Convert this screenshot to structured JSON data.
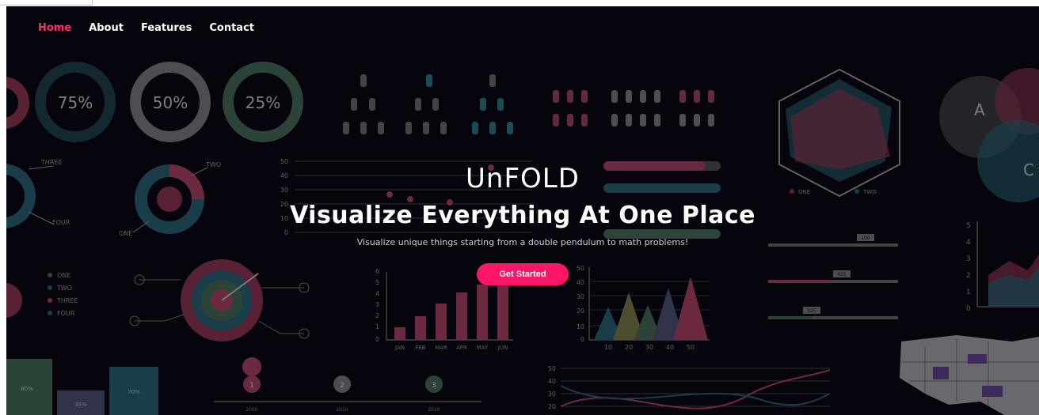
{
  "nav": {
    "items": [
      {
        "label": "Home",
        "active": true
      },
      {
        "label": "About",
        "active": false
      },
      {
        "label": "Features",
        "active": false
      },
      {
        "label": "Contact",
        "active": false
      }
    ]
  },
  "hero": {
    "brand": "UnFOLD",
    "headline": "Visualize Everything At One Place",
    "tagline": "Visualize unique things starting from a double pendulum to math problems!",
    "cta_label": "Get Started"
  },
  "background_decor": {
    "donuts": [
      "75%",
      "50%",
      "25%"
    ],
    "donut_segment_labels": [
      "THREE",
      "FOUR",
      "TWO",
      "ONE"
    ],
    "legend_items": [
      "ONE",
      "TWO",
      "THREE",
      "FOUR"
    ],
    "venn_labels": [
      "A",
      "C"
    ],
    "radar_legend": [
      "ONE",
      "TWO"
    ],
    "line_chart_y_ticks": [
      "50",
      "40",
      "30",
      "20",
      "10",
      "0"
    ],
    "bar_chart_months": [
      "JAN",
      "FEB",
      "MAR",
      "APR",
      "MAY",
      "JUN"
    ],
    "bar_chart_y_ticks": [
      "6",
      "5",
      "4",
      "3",
      "2",
      "1",
      "0"
    ],
    "triangle_chart_x_ticks": [
      "10",
      "20",
      "30",
      "40",
      "50"
    ],
    "triangle_chart_y_ticks": [
      "50",
      "40",
      "30",
      "20",
      "10",
      "0"
    ],
    "area_chart_y_ticks": [
      "5",
      "4",
      "3",
      "2",
      "1",
      "0"
    ],
    "wave_chart_y_ticks": [
      "50",
      "40",
      "30",
      "20"
    ],
    "bottom_bars": [
      "80%",
      "35%",
      "70%"
    ],
    "slider_badges": [
      "100",
      "425",
      "325"
    ],
    "map_pins": [
      "1",
      "2",
      "3"
    ],
    "map_pin_captions": [
      "2000",
      "2010",
      "2020"
    ]
  },
  "colors": {
    "accent": "#ff1667",
    "background": "#06040d",
    "teal": "#2a6f7a",
    "rose": "#9b3a55"
  }
}
